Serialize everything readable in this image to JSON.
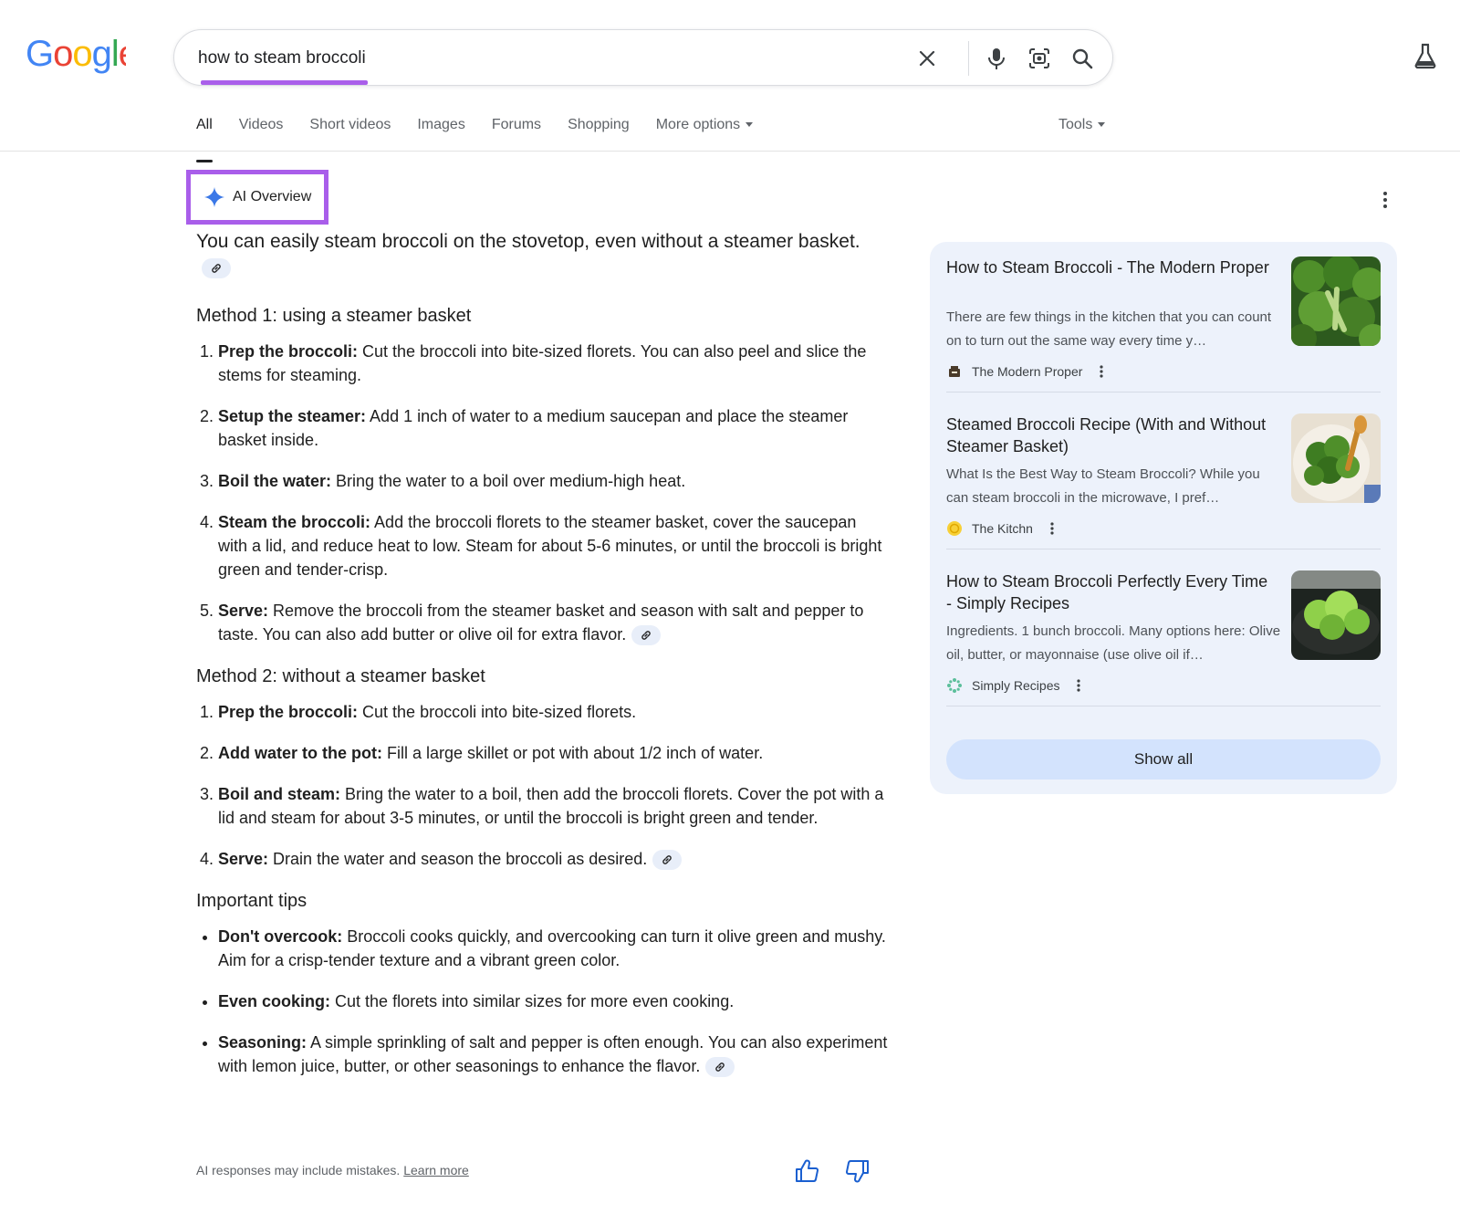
{
  "header": {
    "logo_letters": [
      "G",
      "o",
      "o",
      "g",
      "l",
      "e"
    ],
    "logo_colors": [
      "#4285F4",
      "#EA4335",
      "#FBBC05",
      "#4285F4",
      "#34A853",
      "#EA4335"
    ],
    "search_value": "how to steam broccoli",
    "icons": [
      "close-icon",
      "mic-icon",
      "lens-icon",
      "search-icon",
      "labs-icon"
    ],
    "highlight_color": "#a95eea"
  },
  "tabs": [
    {
      "label": "All",
      "active": true
    },
    {
      "label": "Videos"
    },
    {
      "label": "Short videos"
    },
    {
      "label": "Images"
    },
    {
      "label": "Forums"
    },
    {
      "label": "Shopping"
    },
    {
      "label": "More options"
    }
  ],
  "tools_label": "Tools",
  "ai_overview": {
    "label": "AI Overview",
    "intro": "You can easily steam broccoli on the stovetop, even without a steamer basket.",
    "method1": {
      "title": "Method 1: using a steamer basket",
      "steps": [
        {
          "bold": "Prep the broccoli:",
          "text": " Cut the broccoli into bite-sized florets. You can also peel and slice the stems for steaming."
        },
        {
          "bold": "Setup the steamer:",
          "text": " Add 1 inch of water to a medium saucepan and place the steamer basket inside."
        },
        {
          "bold": "Boil the water:",
          "text": " Bring the water to a boil over medium-high heat."
        },
        {
          "bold": "Steam the broccoli:",
          "text": " Add the broccoli florets to the steamer basket, cover the saucepan with a lid, and reduce heat to low. Steam for about 5-6 minutes, or until the broccoli is bright green and tender-crisp."
        },
        {
          "bold": "Serve:",
          "text": " Remove the broccoli from the steamer basket and season with salt and pepper to taste. You can also add butter or olive oil for extra flavor."
        }
      ]
    },
    "method2": {
      "title": "Method 2: without a steamer basket",
      "steps": [
        {
          "bold": "Prep the broccoli:",
          "text": " Cut the broccoli into bite-sized florets."
        },
        {
          "bold": "Add water to the pot:",
          "text": " Fill a large skillet or pot with about 1/2 inch of water."
        },
        {
          "bold": "Boil and steam:",
          "text": " Bring the water to a boil, then add the broccoli florets. Cover the pot with a lid and steam for about 3-5 minutes, or until the broccoli is bright green and tender."
        },
        {
          "bold": "Serve:",
          "text": " Drain the water and season the broccoli as desired."
        }
      ]
    },
    "tips": {
      "title": "Important tips",
      "items": [
        {
          "bold": "Don't overcook:",
          "text": " Broccoli cooks quickly, and overcooking can turn it olive green and mushy. Aim for a crisp-tender texture and a vibrant green color."
        },
        {
          "bold": "Even cooking:",
          "text": " Cut the florets into similar sizes for more even cooking."
        },
        {
          "bold": "Seasoning:",
          "text": " A simple sprinkling of salt and pepper is often enough. You can also experiment with lemon juice, butter, or other seasonings to enhance the flavor."
        }
      ]
    },
    "footer_note": "AI responses may include mistakes.",
    "learn_more": "Learn more"
  },
  "sources": [
    {
      "title": "How to Steam Broccoli - The Modern Proper",
      "snippet": "There are few things in the kitchen that you can count on to turn out the same way every time y…",
      "site": "The Modern Proper"
    },
    {
      "title": "Steamed Broccoli Recipe (With and Without Steamer Basket)",
      "snippet": "What Is the Best Way to Steam Broccoli? While you can steam broccoli in the microwave, I pref…",
      "site": "The Kitchn"
    },
    {
      "title": "How to Steam Broccoli Perfectly Every Time - Simply Recipes",
      "snippet": "Ingredients. 1 bunch broccoli. Many options here: Olive oil, butter, or mayonnaise (use olive oil if…",
      "site": "Simply Recipes"
    }
  ],
  "show_all_label": "Show all"
}
